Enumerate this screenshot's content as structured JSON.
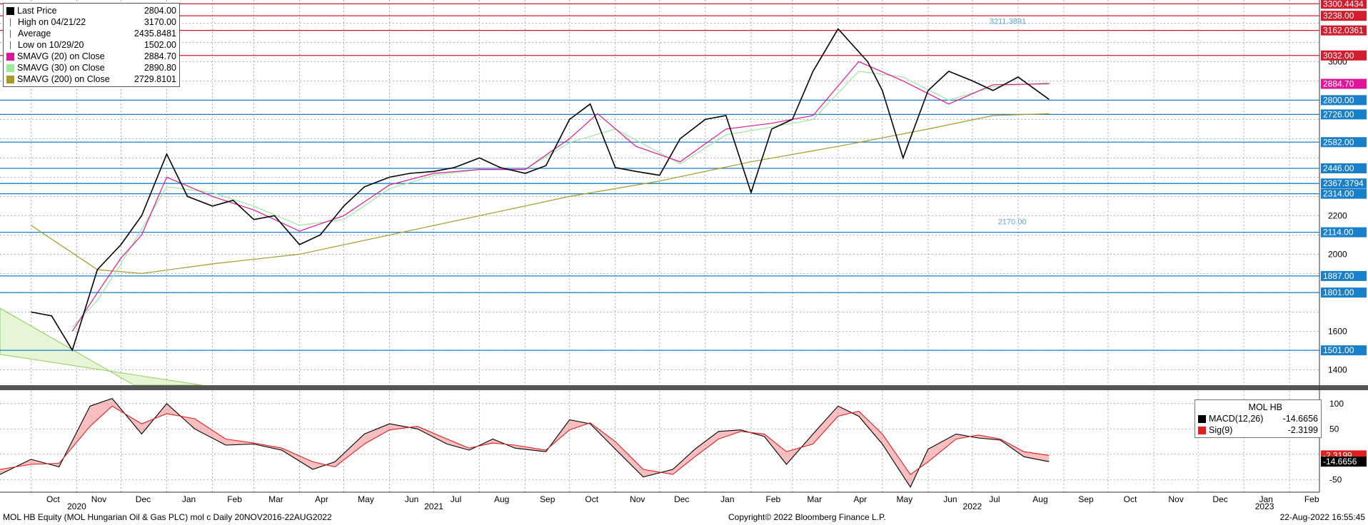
{
  "legend": {
    "items": [
      {
        "label": "Last Price",
        "value": "2804.00",
        "color": "#000000",
        "icon": "square-icon"
      },
      {
        "label": "High on 04/21/22",
        "value": "3170.00",
        "color": "#666666",
        "icon": "high-marker-icon"
      },
      {
        "label": "Average",
        "value": "2435.8481",
        "color": "#666666",
        "icon": "average-marker-icon"
      },
      {
        "label": "Low on 10/29/20",
        "value": "1502.00",
        "color": "#666666",
        "icon": "low-marker-icon"
      },
      {
        "label": "SMAVG (20)  on Close",
        "value": "2884.70",
        "color": "#e0169a",
        "icon": "square-icon"
      },
      {
        "label": "SMAVG (30)  on Close",
        "value": "2890.80",
        "color": "#9ee89a",
        "icon": "square-icon"
      },
      {
        "label": "SMAVG (200)  on Close",
        "value": "2729.8101",
        "color": "#a79a2a",
        "icon": "square-icon"
      }
    ]
  },
  "macd_legend": {
    "title": "MOL HB",
    "items": [
      {
        "label": "MACD(12,26)",
        "value": "-14.6656",
        "color": "#000000"
      },
      {
        "label": "Sig(9)",
        "value": "-2.3199",
        "color": "#e02020"
      }
    ]
  },
  "footer": {
    "left": "MOL HB Equity (MOL Hungarian Oil & Gas PLC) mol c  Daily 20NOV2016-22AUG2022",
    "center": "Copyright© 2022 Bloomberg Finance L.P.",
    "right": "22-Aug-2022 16:55:45"
  },
  "chart_data": [
    {
      "type": "line",
      "title": "",
      "ylim": [
        1320,
        3320
      ],
      "yticks": [
        1400,
        1600,
        2000,
        2200,
        3000
      ],
      "x_months": [
        "Oct",
        "Nov",
        "Dec",
        "Jan",
        "Feb",
        "Mar",
        "Apr",
        "May",
        "Jun",
        "Jul",
        "Aug",
        "Sep",
        "Oct",
        "Nov",
        "Dec",
        "Jan",
        "Feb",
        "Mar",
        "Apr",
        "May",
        "Jun",
        "Jul",
        "Aug",
        "Sep",
        "Oct",
        "Nov",
        "Dec",
        "Jan",
        "Feb"
      ],
      "x_years": [
        "2020",
        "2021",
        "2022",
        "2023"
      ],
      "series": [
        {
          "name": "Last Price",
          "color": "#000000",
          "x": [
            "2020-10-01",
            "2020-10-15",
            "2020-10-29",
            "2020-11-15",
            "2020-12-01",
            "2020-12-15",
            "2021-01-01",
            "2021-01-15",
            "2021-02-01",
            "2021-02-15",
            "2021-03-01",
            "2021-03-15",
            "2021-04-01",
            "2021-04-15",
            "2021-05-01",
            "2021-05-15",
            "2021-06-01",
            "2021-06-15",
            "2021-07-01",
            "2021-07-15",
            "2021-08-01",
            "2021-08-15",
            "2021-09-01",
            "2021-09-15",
            "2021-10-01",
            "2021-10-15",
            "2021-11-01",
            "2021-11-15",
            "2021-12-01",
            "2021-12-15",
            "2022-01-01",
            "2022-01-15",
            "2022-02-01",
            "2022-02-15",
            "2022-03-01",
            "2022-03-15",
            "2022-04-01",
            "2022-04-21",
            "2022-05-01",
            "2022-05-15",
            "2022-06-01",
            "2022-06-15",
            "2022-07-01",
            "2022-07-15",
            "2022-08-01",
            "2022-08-22"
          ],
          "values": [
            1700,
            1680,
            1502,
            1920,
            2050,
            2200,
            2520,
            2300,
            2250,
            2280,
            2180,
            2200,
            2050,
            2100,
            2250,
            2350,
            2400,
            2420,
            2430,
            2450,
            2500,
            2450,
            2420,
            2460,
            2700,
            2780,
            2450,
            2430,
            2410,
            2600,
            2700,
            2720,
            2320,
            2650,
            2700,
            2950,
            3170,
            3000,
            2850,
            2500,
            2850,
            2950,
            2900,
            2850,
            2920,
            2804
          ]
        },
        {
          "name": "SMAVG (20)  on Close",
          "color": "#e0169a",
          "x": [
            "2020-10-29",
            "2020-11-15",
            "2020-12-01",
            "2020-12-15",
            "2021-01-01",
            "2021-02-01",
            "2021-03-01",
            "2021-04-01",
            "2021-05-01",
            "2021-06-01",
            "2021-07-01",
            "2021-08-01",
            "2021-09-01",
            "2021-10-01",
            "2021-10-20",
            "2021-11-15",
            "2021-12-15",
            "2022-01-15",
            "2022-02-15",
            "2022-03-15",
            "2022-04-15",
            "2022-05-15",
            "2022-06-15",
            "2022-07-15",
            "2022-08-22"
          ],
          "values": [
            1600,
            1800,
            1980,
            2100,
            2400,
            2300,
            2230,
            2120,
            2200,
            2360,
            2420,
            2440,
            2440,
            2600,
            2730,
            2560,
            2480,
            2650,
            2680,
            2720,
            3000,
            2900,
            2780,
            2880,
            2884.7
          ]
        },
        {
          "name": "SMAVG (30)  on Close",
          "color": "#9ee89a",
          "x": [
            "2020-10-29",
            "2020-11-15",
            "2020-12-01",
            "2021-01-01",
            "2021-02-01",
            "2021-03-01",
            "2021-04-01",
            "2021-05-01",
            "2021-06-01",
            "2021-07-01",
            "2021-08-01",
            "2021-09-01",
            "2021-10-01",
            "2021-11-01",
            "2021-12-15",
            "2022-01-15",
            "2022-02-15",
            "2022-03-15",
            "2022-04-15",
            "2022-05-15",
            "2022-06-15",
            "2022-07-15",
            "2022-08-22"
          ],
          "values": [
            1620,
            1760,
            1950,
            2350,
            2320,
            2250,
            2150,
            2180,
            2340,
            2410,
            2440,
            2440,
            2580,
            2650,
            2470,
            2620,
            2660,
            2700,
            2950,
            2920,
            2800,
            2870,
            2890.8
          ]
        },
        {
          "name": "SMAVG (200)  on Close",
          "color": "#a79a2a",
          "x": [
            "2020-10-01",
            "2020-11-15",
            "2020-12-15",
            "2021-02-01",
            "2021-04-01",
            "2021-06-01",
            "2021-08-01",
            "2021-10-01",
            "2021-12-01",
            "2022-02-01",
            "2022-04-01",
            "2022-06-01",
            "2022-07-15",
            "2022-08-22"
          ],
          "values": [
            2150,
            1920,
            1900,
            1950,
            2000,
            2100,
            2200,
            2300,
            2380,
            2480,
            2560,
            2650,
            2720,
            2729.81
          ]
        }
      ],
      "hlines": [
        {
          "value": 3300.4434,
          "label": "3300.4434",
          "color": "#d01c2c"
        },
        {
          "value": 3238.0,
          "label": "3238.00",
          "color": "#d01c2c"
        },
        {
          "value": 3162.0361,
          "label": "3162.0361",
          "color": "#d01c2c"
        },
        {
          "value": 3032.0,
          "label": "3032.00",
          "color": "#d01c2c"
        },
        {
          "value": 2800.0,
          "label": "2800.00",
          "color": "#1a7fc9"
        },
        {
          "value": 2726.0,
          "label": "2726.00",
          "color": "#1a7fc9"
        },
        {
          "value": 2582.0,
          "label": "2582.00",
          "color": "#1a7fc9"
        },
        {
          "value": 2446.0,
          "label": "2446.00",
          "color": "#1a7fc9"
        },
        {
          "value": 2367.3794,
          "label": "2367.3794",
          "color": "#1a7fc9"
        },
        {
          "value": 2314.0,
          "label": "2314.00",
          "color": "#1a7fc9"
        },
        {
          "value": 2114.0,
          "label": "2114.00",
          "color": "#1a7fc9"
        },
        {
          "value": 1887.0,
          "label": "1887.00",
          "color": "#1a7fc9"
        },
        {
          "value": 1801.0,
          "label": "1801.00",
          "color": "#1a7fc9"
        },
        {
          "value": 1501.0,
          "label": "1501.00",
          "color": "#1a7fc9"
        }
      ],
      "value_tags": [
        {
          "label": "2884.70",
          "value": 2884.7,
          "color": "#e0169a"
        }
      ],
      "annotations": [
        {
          "text": "3211.3891",
          "value": 3211.3891,
          "x": "2022-07-25",
          "color": "#5aa9d9"
        },
        {
          "text": "2170.00",
          "value": 2170.0,
          "x": "2022-07-28",
          "color": "#5aa9d9"
        }
      ]
    },
    {
      "type": "line",
      "ylim": [
        -75,
        125
      ],
      "yticks": [
        100,
        50,
        0,
        -50
      ],
      "series": [
        {
          "name": "MACD(12,26)",
          "color": "#000000",
          "x": [
            "2020-09-10",
            "2020-10-01",
            "2020-10-20",
            "2020-11-10",
            "2020-11-25",
            "2020-12-15",
            "2021-01-01",
            "2021-01-20",
            "2021-02-10",
            "2021-03-01",
            "2021-03-20",
            "2021-04-10",
            "2021-04-25",
            "2021-05-15",
            "2021-06-01",
            "2021-06-20",
            "2021-07-10",
            "2021-07-25",
            "2021-08-10",
            "2021-08-25",
            "2021-09-15",
            "2021-10-01",
            "2021-10-15",
            "2021-11-01",
            "2021-11-20",
            "2021-12-10",
            "2021-12-25",
            "2022-01-10",
            "2022-01-25",
            "2022-02-10",
            "2022-02-25",
            "2022-03-15",
            "2022-04-01",
            "2022-04-15",
            "2022-05-01",
            "2022-05-20",
            "2022-06-01",
            "2022-06-20",
            "2022-07-05",
            "2022-07-20",
            "2022-08-05",
            "2022-08-22"
          ],
          "values": [
            -40,
            -10,
            -25,
            95,
            110,
            40,
            100,
            50,
            18,
            20,
            8,
            -30,
            -15,
            40,
            60,
            50,
            20,
            8,
            30,
            12,
            5,
            68,
            60,
            10,
            -45,
            -30,
            10,
            45,
            48,
            35,
            -20,
            40,
            95,
            75,
            20,
            -65,
            10,
            40,
            32,
            28,
            -5,
            -14.67
          ]
        },
        {
          "name": "Sig(9)",
          "color": "#e02020",
          "x": [
            "2020-09-10",
            "2020-10-01",
            "2020-10-20",
            "2020-11-10",
            "2020-11-25",
            "2020-12-15",
            "2021-01-01",
            "2021-01-20",
            "2021-02-10",
            "2021-03-01",
            "2021-03-20",
            "2021-04-10",
            "2021-04-25",
            "2021-05-15",
            "2021-06-01",
            "2021-06-20",
            "2021-07-10",
            "2021-07-25",
            "2021-08-10",
            "2021-08-25",
            "2021-09-15",
            "2021-10-01",
            "2021-10-15",
            "2021-11-01",
            "2021-11-20",
            "2021-12-10",
            "2021-12-25",
            "2022-01-10",
            "2022-01-25",
            "2022-02-10",
            "2022-02-25",
            "2022-03-15",
            "2022-04-01",
            "2022-04-15",
            "2022-05-01",
            "2022-05-20",
            "2022-06-01",
            "2022-06-20",
            "2022-07-05",
            "2022-07-20",
            "2022-08-05",
            "2022-08-22"
          ],
          "values": [
            -30,
            -20,
            -18,
            55,
            95,
            60,
            80,
            70,
            30,
            22,
            12,
            -15,
            -25,
            20,
            48,
            55,
            30,
            12,
            22,
            18,
            8,
            48,
            62,
            25,
            -30,
            -40,
            -5,
            30,
            45,
            40,
            5,
            20,
            75,
            85,
            40,
            -40,
            -15,
            30,
            38,
            30,
            5,
            -2.32
          ]
        }
      ],
      "value_tags": [
        {
          "label": "-2.3199",
          "value": -2.32,
          "color": "#e02020"
        },
        {
          "label": "-14.6656",
          "value": -14.67,
          "color": "#000000"
        }
      ]
    }
  ]
}
